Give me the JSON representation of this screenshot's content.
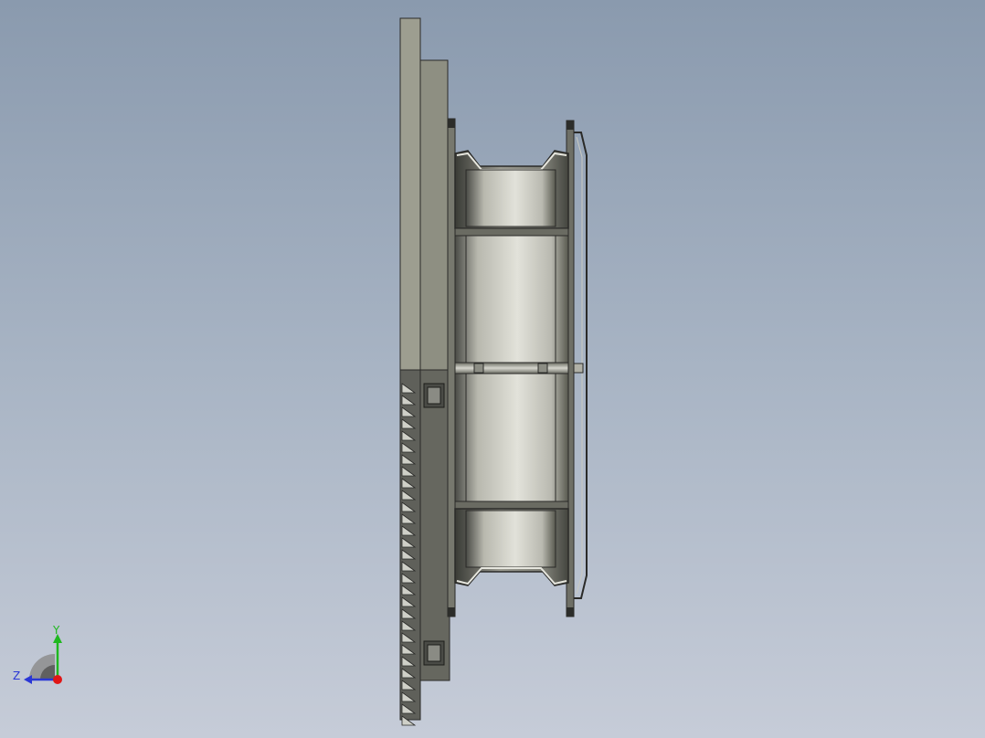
{
  "viewport": {
    "background_top": "#8a9aae",
    "background_bottom": "#c6ccd8"
  },
  "model": {
    "icon": "cad-fan-side-view",
    "colors": {
      "panel_light": "#9c9d8f",
      "panel_dark": "#5f605a",
      "edge": "#2a2a28",
      "metal_light": "#dcdcd4",
      "metal_dark": "#4a4b46"
    }
  },
  "triad": {
    "y_label": "Y",
    "z_label": "Z",
    "y_color": "#1fb81f",
    "z_color": "#2a37d6",
    "x_color": "#e01616"
  }
}
